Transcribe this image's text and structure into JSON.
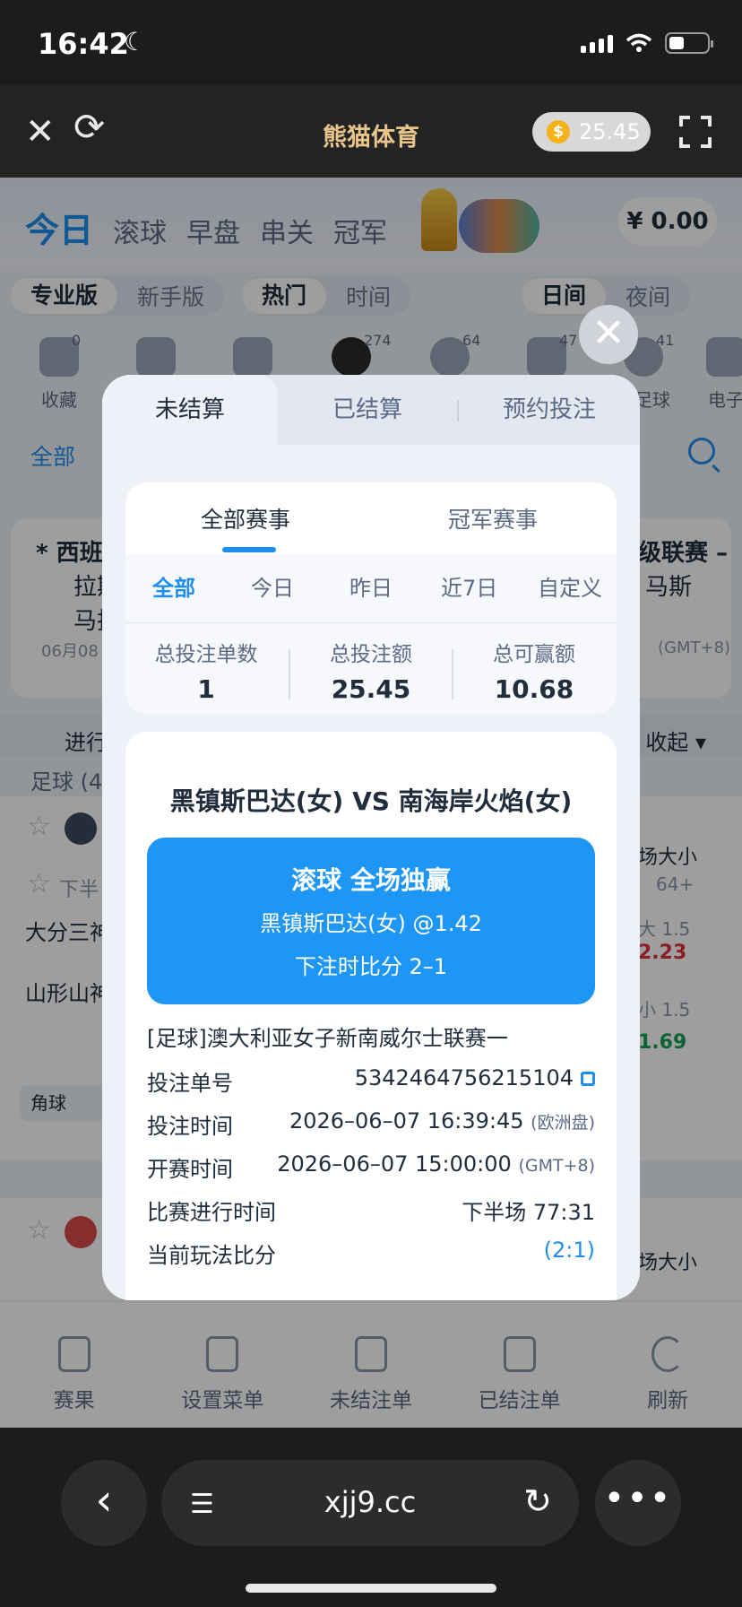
{
  "status": {
    "time": "16:42"
  },
  "app": {
    "title": "熊猫体育",
    "coin_balance": "25.45"
  },
  "page": {
    "top_tabs": [
      "今日",
      "滚球",
      "早盘",
      "串关",
      "冠军"
    ],
    "balance": "¥ 0.00",
    "mode": [
      "专业版",
      "新手版"
    ],
    "sort": [
      "热门",
      "时间"
    ],
    "theme": [
      "日间",
      "夜间"
    ],
    "sports": [
      {
        "label": "收藏",
        "count": "0"
      },
      {
        "label": "",
        "count": ""
      },
      {
        "label": "",
        "count": ""
      },
      {
        "label": "",
        "count": "274"
      },
      {
        "label": "",
        "count": "64"
      },
      {
        "label": "",
        "count": "47"
      },
      {
        "label": "子足球",
        "count": "41"
      },
      {
        "label": "电子",
        "count": ""
      }
    ],
    "filter_all": "全部",
    "match_card": {
      "left_line1": "* 西班",
      "left_line2": "拉斯",
      "left_line3": "马托",
      "left_date": "06月08",
      "right_line1": "级联赛 –",
      "right_line2": "马斯",
      "right_tz": "(GMT+8)"
    },
    "list_head": {
      "left": "进行",
      "right": "收起 ▾"
    },
    "sub_head": "足球 (4",
    "rows": {
      "r1_right": "场大小",
      "r1_sub": "下半",
      "r1_more": "64+",
      "team1": "大分三神",
      "team2": "山形山神",
      "big": "大 1.5",
      "big_odds": "2.23",
      "small": "小 1.5",
      "small_odds": "1.69",
      "corner": "角球",
      "r2_right": "场大小"
    },
    "nav": [
      "赛果",
      "设置菜单",
      "未结注单",
      "已结注单",
      "刷新"
    ]
  },
  "browser": {
    "url": "xjj9.cc"
  },
  "modal": {
    "tabs": [
      "未结算",
      "已结算",
      "预约投注"
    ],
    "sub_tabs": [
      "全部赛事",
      "冠军赛事"
    ],
    "ranges": [
      "全部",
      "今日",
      "昨日",
      "近7日",
      "自定义"
    ],
    "stats": [
      {
        "label": "总投注单数",
        "value": "1"
      },
      {
        "label": "总投注额",
        "value": "25.45"
      },
      {
        "label": "总可赢额",
        "value": "10.68"
      }
    ],
    "bet": {
      "match": "黑镇斯巴达(女)  VS  南海岸火焰(女)",
      "market": "滚球  全场独赢",
      "selection": "黑镇斯巴达(女)    @1.42",
      "score_at_bet": "下注时比分 2–1",
      "league": "[足球]澳大利亚女子新南威尔士联赛一",
      "details": [
        {
          "label": "投注单号",
          "value": "5342464756215104",
          "note": ""
        },
        {
          "label": "投注时间",
          "value": "2026–06–07 16:39:45",
          "note": "(欧洲盘)"
        },
        {
          "label": "开赛时间",
          "value": "2026–06–07 15:00:00",
          "note": "(GMT+8)"
        },
        {
          "label": "比赛进行时间",
          "value": "下半场 77:31",
          "note": ""
        },
        {
          "label": "当前玩法比分",
          "value": "(2:1)",
          "note": ""
        }
      ]
    }
  }
}
